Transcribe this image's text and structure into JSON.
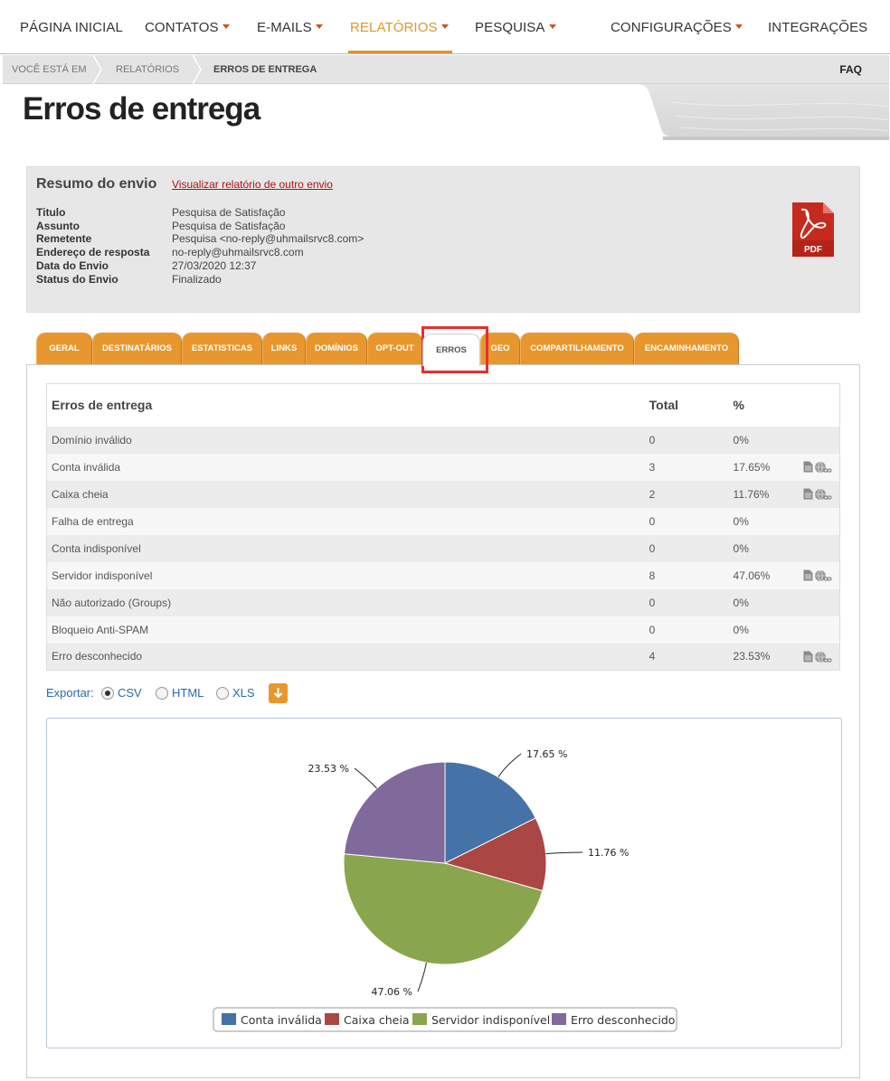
{
  "nav": {
    "items": [
      {
        "label": "PÁGINA INICIAL",
        "caret": false,
        "active": false
      },
      {
        "label": "CONTATOS",
        "caret": true,
        "active": false
      },
      {
        "label": "E-MAILS",
        "caret": true,
        "active": false
      },
      {
        "label": "RELATÓRIOS",
        "caret": true,
        "active": true
      },
      {
        "label": "PESQUISA",
        "caret": true,
        "active": false
      },
      {
        "label": "CONFIGURAÇÕES",
        "caret": true,
        "active": false
      },
      {
        "label": "INTEGRAÇÕES",
        "caret": false,
        "active": false
      }
    ]
  },
  "breadcrumb": {
    "items": [
      "VOCÊ ESTÁ EM",
      "RELATÓRIOS",
      "ERROS DE ENTREGA"
    ],
    "faq": "FAQ"
  },
  "page_title": "Erros de entrega",
  "summary": {
    "title": "Resumo do envio",
    "link": "Visualizar relatório de outro envio",
    "rows": [
      {
        "label": "Titulo",
        "value": "Pesquisa de Satisfação"
      },
      {
        "label": "Assunto",
        "value": "Pesquisa de Satisfação"
      },
      {
        "label": "Remetente",
        "value": "Pesquisa <no-reply@uhmailsrvc8.com>"
      },
      {
        "label": "Endereço de resposta",
        "value": "no-reply@uhmailsrvc8.com"
      },
      {
        "label": "Data do Envio",
        "value": "27/03/2020 12:37"
      },
      {
        "label": "Status do Envio",
        "value": "Finalizado"
      }
    ],
    "pdf_label": "PDF"
  },
  "tabs": [
    "GERAL",
    "DESTINATÁRIOS",
    "ESTATISTICAS",
    "LINKS",
    "DOMÍNIOS",
    "OPT-OUT",
    "ERROS",
    "GEO",
    "COMPARTILHAMENTO",
    "ENCAMINHAMENTO"
  ],
  "active_tab": "ERROS",
  "table": {
    "headers": [
      "Erros de entrega",
      "Total",
      "%"
    ],
    "rows": [
      {
        "name": "Domínio inválido",
        "total": "0",
        "pct": "0%",
        "actions": false
      },
      {
        "name": "Conta inválida",
        "total": "3",
        "pct": "17.65%",
        "actions": true
      },
      {
        "name": "Caixa cheia",
        "total": "2",
        "pct": "11.76%",
        "actions": true
      },
      {
        "name": "Falha de entrega",
        "total": "0",
        "pct": "0%",
        "actions": false
      },
      {
        "name": "Conta indisponível",
        "total": "0",
        "pct": "0%",
        "actions": false
      },
      {
        "name": "Servidor indisponível",
        "total": "8",
        "pct": "47.06%",
        "actions": true
      },
      {
        "name": "Não autorizado (Groups)",
        "total": "0",
        "pct": "0%",
        "actions": false
      },
      {
        "name": "Bloqueio Anti-SPAM",
        "total": "0",
        "pct": "0%",
        "actions": false
      },
      {
        "name": "Erro desconhecido",
        "total": "4",
        "pct": "23.53%",
        "actions": true
      }
    ]
  },
  "export": {
    "label": "Exportar:",
    "options": [
      {
        "label": "CSV",
        "checked": true
      },
      {
        "label": "HTML",
        "checked": false
      },
      {
        "label": "XLS",
        "checked": false
      }
    ],
    "button_icon": "download-arrow-icon"
  },
  "chart_data": {
    "type": "pie",
    "slices": [
      {
        "name": "Conta inválida",
        "value": 17.65,
        "label": "17.65 %",
        "color": "#4572a7"
      },
      {
        "name": "Caixa cheia",
        "value": 11.76,
        "label": "11.76 %",
        "color": "#aa4643"
      },
      {
        "name": "Servidor indisponível",
        "value": 47.06,
        "label": "47.06 %",
        "color": "#89a54e"
      },
      {
        "name": "Erro desconhecido",
        "value": 23.53,
        "label": "23.53 %",
        "color": "#80699b"
      }
    ],
    "legend": "bottom-center"
  },
  "colors": {
    "accent": "#e8972e",
    "highlight": "#e53030",
    "link": "#2a6aa8"
  }
}
